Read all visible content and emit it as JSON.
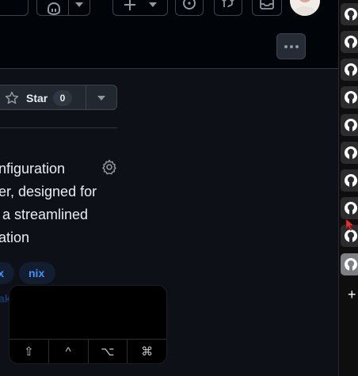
{
  "repo": {
    "star_label": "Star",
    "star_count": "0",
    "about_lines": [
      "nfiguration",
      "er, designed for",
      " a streamlined",
      "ation"
    ],
    "topics": [
      "x",
      "nix"
    ],
    "topic_partial": "ake-parts"
  },
  "keyboard": {
    "keys": [
      "⇧",
      "^",
      "⌥",
      "⌘"
    ]
  },
  "dock": {
    "plus_label": "+"
  },
  "colors": {
    "background": "#0d1117",
    "accent": "#4493f8",
    "border": "#3d444d"
  }
}
